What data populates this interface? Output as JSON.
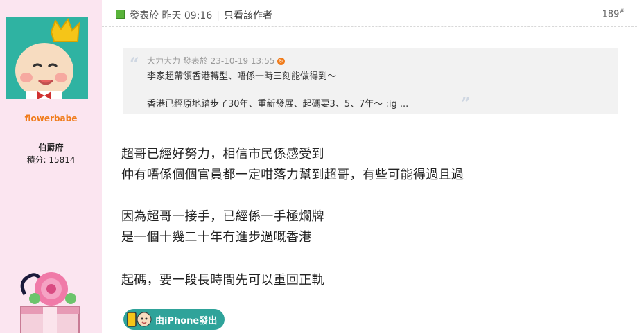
{
  "user": {
    "username": "flowerbabe",
    "rank": "伯爵府",
    "points_label": "積分: 15814"
  },
  "post": {
    "posted_label": "發表於 昨天 09:16",
    "separator": "|",
    "only_author": "只看該作者",
    "floor": "189",
    "floor_mark": "#"
  },
  "quote": {
    "author_line": "大力大力 發表於 23-10-19 13:55",
    "line1": "李家超帶領香港轉型、唔係一時三刻能做得到～",
    "line2": "香港已經原地踏步了30年、重新發展、起碼要3、5、7年～ :ig ..."
  },
  "body": {
    "lines": [
      "超哥已經好努力，相信市民係感受到",
      "仲有唔係個個官員都一定咁落力幫到超哥，有些可能得過且過",
      "因為超哥一接手，已經係一手極爛牌",
      "是一個十幾二十年冇進步過嘅香港",
      "起碼，要一段長時間先可以重回正軌"
    ]
  },
  "badge": {
    "label": "由iPhone發出"
  },
  "colors": {
    "sidebar_bg": "#fbe5f0",
    "username": "#f07c1c",
    "badge_bg": "#2fa39a",
    "quote_bg": "#f2f2f2"
  }
}
